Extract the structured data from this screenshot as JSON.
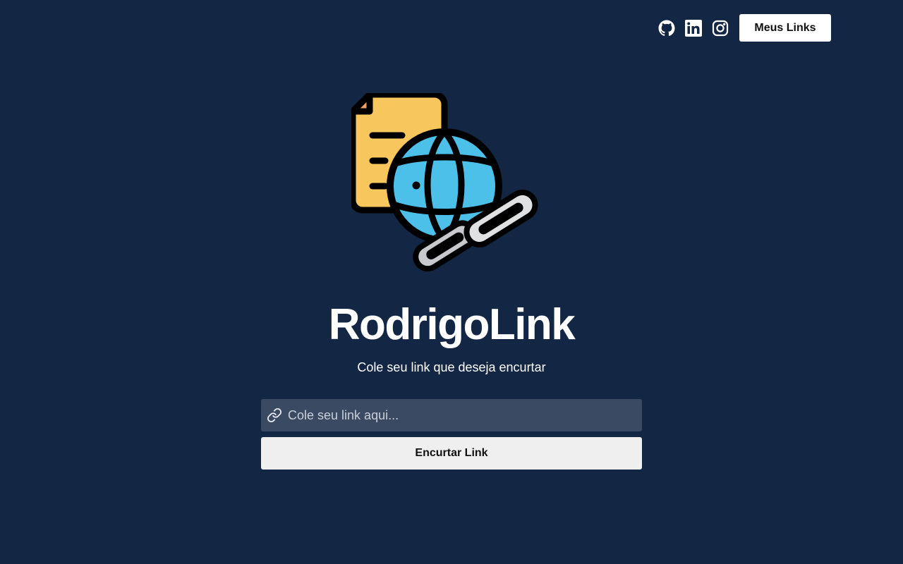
{
  "header": {
    "social_icons": [
      "github-icon",
      "linkedin-icon",
      "instagram-icon"
    ],
    "my_links_label": "Meus Links"
  },
  "hero": {
    "logo_icon": "document-globe-chain-icon",
    "title": "RodrigoLink",
    "subtitle": "Cole seu link que deseja encurtar"
  },
  "form": {
    "input_icon": "link-icon",
    "input_placeholder": "Cole seu link aqui...",
    "input_value": "",
    "submit_label": "Encurtar Link"
  },
  "colors": {
    "background": "#132644",
    "input_background": "#3a4a62",
    "primary_button": "#efefef",
    "header_button": "#ffffff",
    "logo_document": "#f7c75d",
    "logo_globe": "#4dc0ea",
    "logo_chain": "#c7c9cc"
  }
}
